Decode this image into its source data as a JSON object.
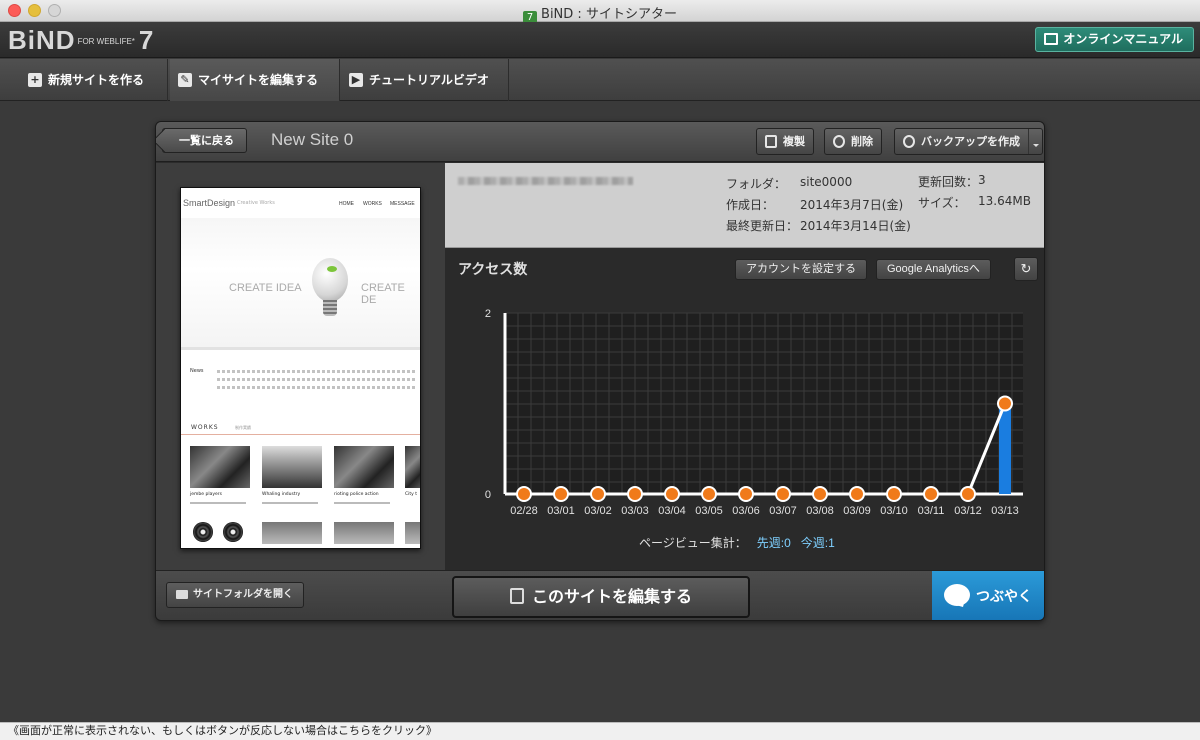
{
  "window": {
    "title": "BiND : サイトシアター",
    "app_icon_label": "7"
  },
  "header": {
    "logo_main": "BiND",
    "logo_sub": "FOR WEBLIFE*",
    "logo_version": "7",
    "manual_button": "オンラインマニュアル"
  },
  "nav": {
    "tabs": [
      {
        "label": "新規サイトを作る",
        "icon": "plus-icon"
      },
      {
        "label": "マイサイトを編集する",
        "icon": "pencil-icon"
      },
      {
        "label": "チュートリアルビデオ",
        "icon": "play-icon"
      }
    ]
  },
  "panel": {
    "back_button": "一覧に戻る",
    "site_title": "New Site 0",
    "buttons": {
      "copy": "複製",
      "delete": "削除",
      "backup": "バックアップを作成"
    },
    "info": {
      "folder_label": "フォルダ：",
      "folder_value": "site0000",
      "created_label": "作成日：",
      "created_value": "2014年3月7日(金)",
      "modified_label": "最終更新日：",
      "modified_value": "2014年3月14日(金)",
      "update_count_label": "更新回数：",
      "update_count_value": "3",
      "size_label": "サイズ：",
      "size_value": "13.64MB"
    },
    "access": {
      "title": "アクセス数",
      "account_button": "アカウントを設定する",
      "ga_button": "Google Analyticsへ",
      "refresh_icon": "refresh-icon",
      "summary_label": "ページビュー集計：",
      "last_week": "先週:0",
      "this_week": "今週:1"
    },
    "bottom": {
      "open_folder": "サイトフォルダを開く",
      "edit_site": "このサイトを編集する",
      "tweet": "つぶやく"
    }
  },
  "thumbnail": {
    "logo": "SmartDesign",
    "logo_sub": "Creative Works",
    "nav": [
      "HOME",
      "WORKS",
      "MESSAGE"
    ],
    "hero_text_left": "CREATE IDEA",
    "hero_text_right": "CREATE DE",
    "news_label": "News",
    "works_label": "WORKS",
    "works_sub": "制作実績",
    "captions": [
      "jembe players",
      "Whaling industry",
      "rioting police action",
      "City t"
    ]
  },
  "chart_data": {
    "type": "line",
    "title": "アクセス数",
    "categories": [
      "02/28",
      "03/01",
      "03/02",
      "03/03",
      "03/04",
      "03/05",
      "03/06",
      "03/07",
      "03/08",
      "03/09",
      "03/10",
      "03/11",
      "03/12",
      "03/13"
    ],
    "values": [
      0,
      0,
      0,
      0,
      0,
      0,
      0,
      0,
      0,
      0,
      0,
      0,
      0,
      1
    ],
    "ylim": [
      0,
      2
    ],
    "y_ticks": [
      0,
      2
    ],
    "grid": true,
    "colors": {
      "line": "#ffffff",
      "point": "#f07a1a",
      "bar": "#1a7de0"
    }
  },
  "footer": {
    "text": "《画面が正常に表示されない、もしくはボタンが反応しない場合はこちらをクリック》"
  }
}
